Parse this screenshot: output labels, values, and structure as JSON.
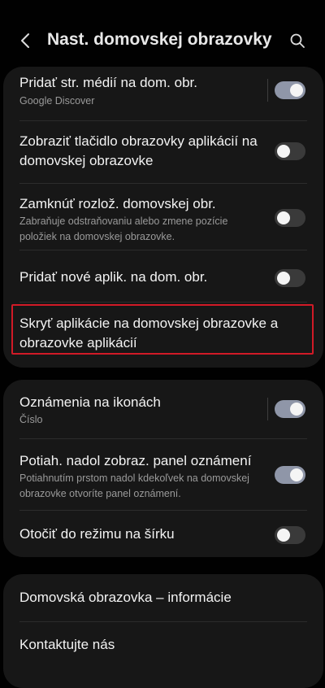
{
  "header": {
    "title": "Nast. domovskej obrazovky",
    "back_icon": "chevron-left-icon",
    "search_icon": "search-icon"
  },
  "group1": {
    "items": [
      {
        "title": "Pridať str. médií na dom. obr.",
        "subtitle": "Google Discover",
        "toggle": true
      },
      {
        "title": "Zobraziť tlačidlo obrazovky aplikácií na domovskej obrazovke",
        "toggle": false
      },
      {
        "title": "Zamknúť rozlož. domovskej obr.",
        "subtitle": "Zabraňuje odstraňovaniu alebo zmene pozície položiek na domovskej obrazovke.",
        "toggle": false
      },
      {
        "title": "Pridať nové aplik. na dom. obr.",
        "toggle": false
      },
      {
        "title": "Skryť aplikácie na domovskej obrazovke a obrazovke aplikácií"
      }
    ]
  },
  "group2": {
    "items": [
      {
        "title": "Oznámenia na ikonách",
        "subtitle": "Číslo",
        "toggle": true
      },
      {
        "title": "Potiah. nadol zobraz. panel oznámení",
        "subtitle": "Potiahnutím prstom nadol kdekoľvek na domovskej obrazovke otvoríte panel oznámení.",
        "toggle": true
      },
      {
        "title": "Otočiť do režimu na šírku",
        "toggle": false
      }
    ]
  },
  "group3": {
    "items": [
      {
        "title": "Domovská obrazovka – informácie"
      },
      {
        "title": "Kontaktujte nás"
      }
    ]
  },
  "colors": {
    "background": "#010101",
    "card": "#171717",
    "toggle_on": "#8f96a8",
    "toggle_off": "#3a3a3a",
    "highlight": "#d11a27"
  }
}
